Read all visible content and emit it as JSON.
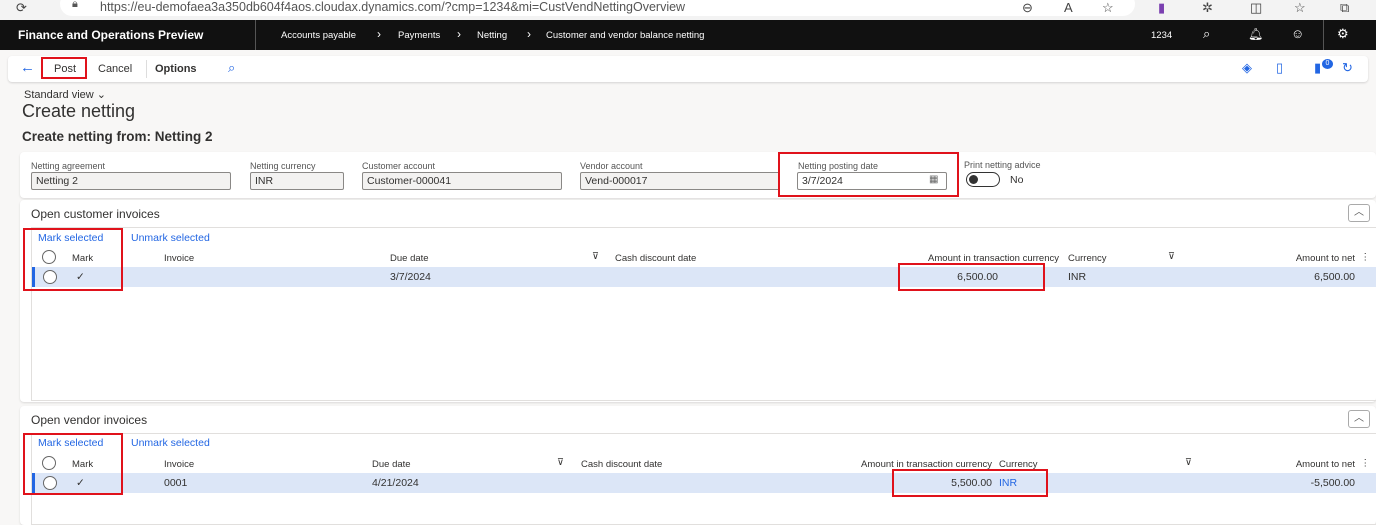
{
  "browser": {
    "url": "https://eu-demofaea3a350db604f4aos.cloudax.dynamics.com/?cmp=1234&mi=CustVendNettingOverview"
  },
  "topbar": {
    "app_title": "Finance and Operations Preview",
    "breadcrumb": [
      "Accounts payable",
      "Payments",
      "Netting",
      "Customer and vendor balance netting"
    ],
    "company": "1234"
  },
  "actions": {
    "post": "Post",
    "cancel": "Cancel",
    "options": "Options",
    "notification_count": "0"
  },
  "page": {
    "view": "Standard view",
    "title": "Create netting",
    "subtitle": "Create netting from: Netting 2"
  },
  "fields": {
    "agreement": {
      "label": "Netting agreement",
      "value": "Netting 2"
    },
    "currency": {
      "label": "Netting currency",
      "value": "INR"
    },
    "customer": {
      "label": "Customer account",
      "value": "Customer-000041"
    },
    "vendor": {
      "label": "Vendor account",
      "value": "Vend-000017"
    },
    "posting_date": {
      "label": "Netting posting date",
      "value": "3/7/2024"
    },
    "print_advice": {
      "label": "Print netting advice",
      "value": "No"
    }
  },
  "customer_invoices": {
    "title": "Open customer invoices",
    "mark_selected": "Mark selected",
    "unmark_selected": "Unmark selected",
    "columns": [
      "Mark",
      "Invoice",
      "Due date",
      "Cash discount date",
      "Amount in transaction currency",
      "Currency",
      "Amount to net"
    ],
    "rows": [
      {
        "mark": "✓",
        "invoice": "",
        "due_date": "3/7/2024",
        "cash_discount_date": "",
        "amount": "6,500.00",
        "currency": "INR",
        "amount_to_net": "6,500.00"
      }
    ]
  },
  "vendor_invoices": {
    "title": "Open vendor invoices",
    "mark_selected": "Mark selected",
    "unmark_selected": "Unmark selected",
    "columns": [
      "Mark",
      "Invoice",
      "Due date",
      "Cash discount date",
      "Amount in transaction currency",
      "Currency",
      "Amount to net"
    ],
    "rows": [
      {
        "mark": "✓",
        "invoice": "0001",
        "due_date": "4/21/2024",
        "cash_discount_date": "",
        "amount": "5,500.00",
        "currency": "INR",
        "amount_to_net": "-5,500.00"
      }
    ]
  }
}
